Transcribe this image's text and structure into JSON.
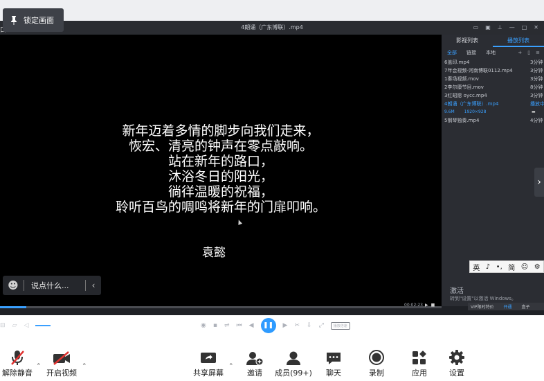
{
  "lock_pill": {
    "label": "锁定画面"
  },
  "player": {
    "title": "4朗诵（广东博联）.mp4",
    "left_edge": "口"
  },
  "video": {
    "poem": [
      "新年迈着多情的脚步向我们走来，",
      "恢宏、清亮的钟声在零点敲响。",
      "站在新年的路口，",
      "沐浴冬日的阳光，",
      "徜徉温暖的祝福，",
      "聆听百鸟的啁鸣将新年的门扉叩响。"
    ],
    "author": "袁懿"
  },
  "sidebar": {
    "tabs": [
      "影视列表",
      "播放列表"
    ],
    "subtabs": [
      "全部",
      "链接",
      "本地"
    ],
    "items": [
      {
        "name": "6盖印.mp4",
        "dur": "3分钟"
      },
      {
        "name": "7年会视频-河南博联0112.mp4",
        "dur": "3分钟"
      },
      {
        "name": "1秦场视频.mov",
        "dur": "3分钟"
      },
      {
        "name": "2李尔康节目.mov",
        "dur": "8分钟"
      },
      {
        "name": "3红昭愿 oycc.mp4",
        "dur": "3分钟"
      },
      {
        "name": "4朗诵（广东博联）.mp4",
        "dur": "播放中"
      },
      {
        "name": "5钢琴独奏.mp4",
        "dur": "4分钟"
      }
    ],
    "active_meta": {
      "size": "9.6M",
      "res": "1920×928"
    }
  },
  "ime": [
    "英",
    "♪",
    "•,",
    "简",
    "☺",
    "⚙"
  ],
  "chat": {
    "placeholder": "说点什么..."
  },
  "playback": {
    "time": "00:02:23",
    "progress": 0.06,
    "speed_label": "播放倍速"
  },
  "watermark": {
    "line1": "激活",
    "line2": "转到\"设置\"以激活 Windows。",
    "vip": "VIP限时特价",
    "btn1": "开通",
    "btn2": "盒子"
  },
  "toolbar": {
    "mute": "解除静音",
    "video": "开启视频",
    "share": "共享屏幕",
    "invite": "邀请",
    "members": "成员(99+)",
    "chat": "聊天",
    "record": "录制",
    "apps": "应用",
    "settings": "设置"
  },
  "colors": {
    "accent": "#3aa0ff",
    "player_bg": "#1f2126",
    "mute_red": "#e0312f"
  }
}
